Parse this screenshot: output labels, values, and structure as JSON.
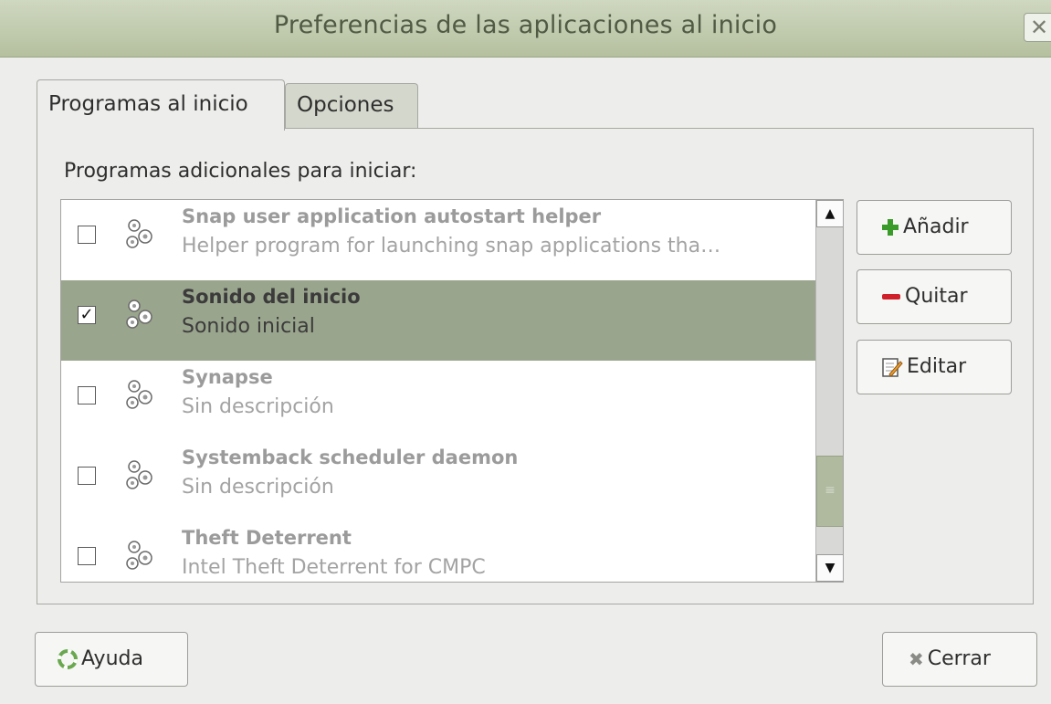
{
  "window": {
    "title": "Preferencias de las aplicaciones al inicio",
    "close_glyph": "✕"
  },
  "tabs": [
    {
      "label": "Programas al inicio",
      "active": true
    },
    {
      "label": "Opciones",
      "active": false
    }
  ],
  "section_label": "Programas adicionales para iniciar:",
  "programs": [
    {
      "name": "Snap user application autostart helper",
      "description": "Helper program for launching snap applications tha…",
      "checked": false,
      "selected": false,
      "icon": "gears-icon"
    },
    {
      "name": "Sonido del inicio",
      "description": "Sonido inicial",
      "checked": true,
      "selected": true,
      "icon": "gears-icon"
    },
    {
      "name": "Synapse",
      "description": "Sin descripción",
      "checked": false,
      "selected": false,
      "icon": "gears-icon"
    },
    {
      "name": "Systemback scheduler daemon",
      "description": "Sin descripción",
      "checked": false,
      "selected": false,
      "icon": "gears-icon"
    },
    {
      "name": "Theft Deterrent",
      "description": "Intel Theft Deterrent for CMPC",
      "checked": false,
      "selected": false,
      "icon": "gears-icon"
    }
  ],
  "scrollbar": {
    "up_glyph": "▲",
    "down_glyph": "▼",
    "grip_glyph": "≡",
    "position_fraction": 0.75
  },
  "buttons": {
    "add": "Añadir",
    "remove": "Quitar",
    "edit": "Editar",
    "help": "Ayuda",
    "close": "Cerrar"
  },
  "colors": {
    "titlebar": "#b5c09f",
    "selection": "#9aa58d",
    "add_icon": "#3a9a2a",
    "remove_icon": "#d0212b"
  }
}
